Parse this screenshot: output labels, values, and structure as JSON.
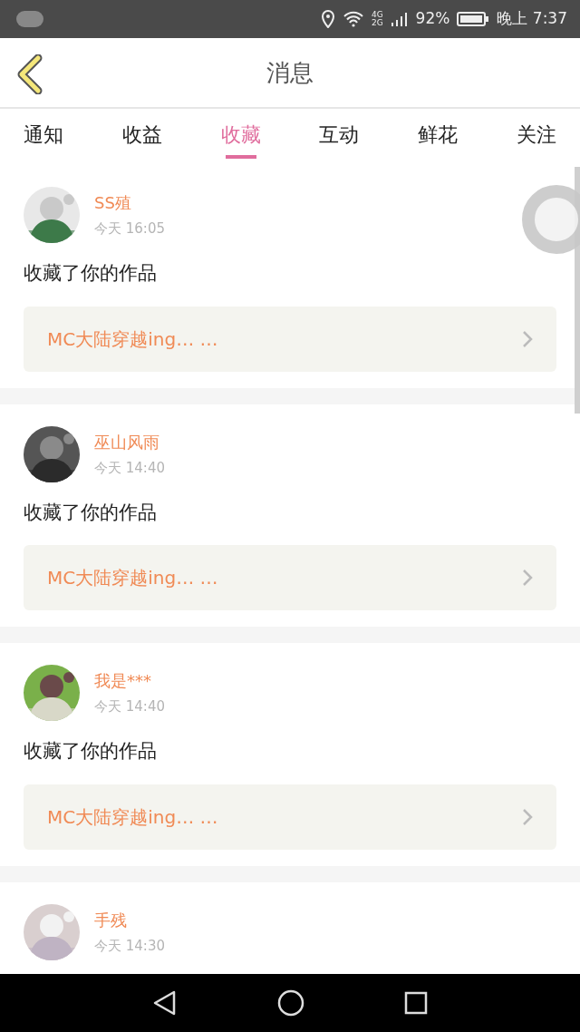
{
  "status_bar": {
    "signal_labels": [
      "4G",
      "2G"
    ],
    "battery": "92%",
    "time": "晚上 7:37"
  },
  "header": {
    "title": "消息"
  },
  "tabs": [
    {
      "label": "通知",
      "selected": false
    },
    {
      "label": "收益",
      "selected": false
    },
    {
      "label": "收藏",
      "selected": true
    },
    {
      "label": "互动",
      "selected": false
    },
    {
      "label": "鲜花",
      "selected": false
    },
    {
      "label": "关注",
      "selected": false
    }
  ],
  "messages": [
    {
      "user": "SS殖",
      "time": "今天 16:05",
      "action": "收藏了你的作品",
      "work": "MC大陆穿越ing… …"
    },
    {
      "user": "巫山风雨",
      "time": "今天 14:40",
      "action": "收藏了你的作品",
      "work": "MC大陆穿越ing… …"
    },
    {
      "user": "我是***",
      "time": "今天 14:40",
      "action": "收藏了你的作品",
      "work": "MC大陆穿越ing… …"
    },
    {
      "user": "手残",
      "time": "今天 14:30"
    }
  ]
}
